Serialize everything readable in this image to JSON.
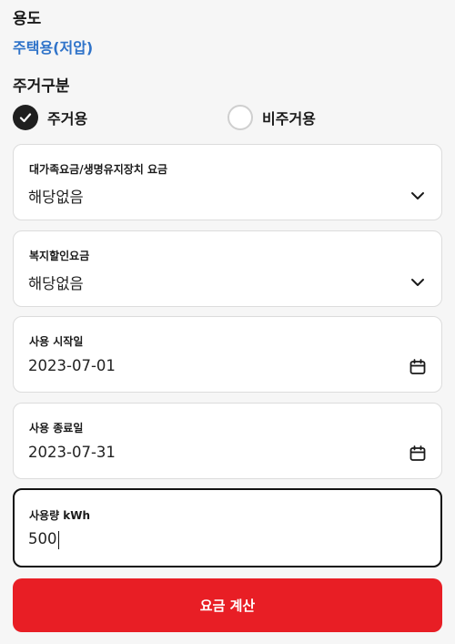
{
  "usage": {
    "label": "용도",
    "value": "주택용(저압)"
  },
  "housing": {
    "label": "주거구분",
    "options": [
      {
        "label": "주거용",
        "checked": true
      },
      {
        "label": "비주거용",
        "checked": false
      }
    ]
  },
  "fields": {
    "family_rate": {
      "label": "대가족요금/생명유지장치 요금",
      "value": "해당없음",
      "icon": "chevron-down-icon"
    },
    "welfare_discount": {
      "label": "복지할인요금",
      "value": "해당없음",
      "icon": "chevron-down-icon"
    },
    "start_date": {
      "label": "사용 시작일",
      "value": "2023-07-01",
      "icon": "calendar-icon"
    },
    "end_date": {
      "label": "사용 종료일",
      "value": "2023-07-31",
      "icon": "calendar-icon"
    },
    "usage_kwh": {
      "label": "사용량 kWh",
      "value": "500"
    }
  },
  "submit": {
    "label": "요금 계산"
  },
  "colors": {
    "link": "#2f73c9",
    "accent": "#e81e25",
    "checked": "#1f1f1f"
  }
}
